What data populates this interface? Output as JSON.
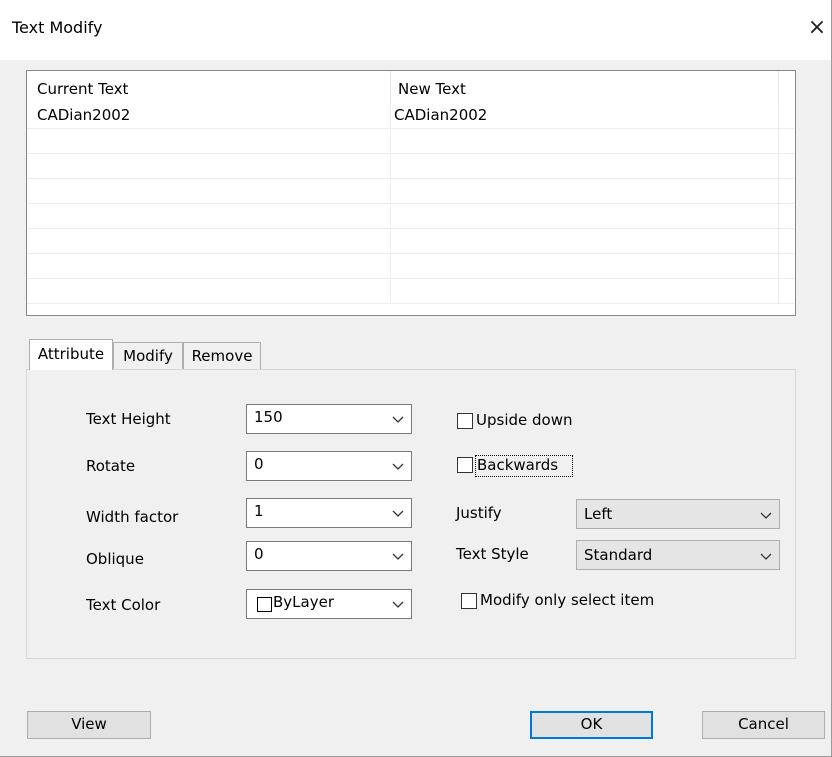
{
  "window": {
    "title": "Text Modify",
    "close_glyph": "×"
  },
  "list": {
    "columns": [
      "Current Text",
      "New Text"
    ],
    "rows": [
      {
        "current": "CADian2002",
        "new": "CADian2002"
      },
      {
        "current": "",
        "new": ""
      },
      {
        "current": "",
        "new": ""
      },
      {
        "current": "",
        "new": ""
      },
      {
        "current": "",
        "new": ""
      },
      {
        "current": "",
        "new": ""
      },
      {
        "current": "",
        "new": ""
      },
      {
        "current": "",
        "new": ""
      }
    ]
  },
  "tabs": [
    {
      "label": "Attribute",
      "active": true
    },
    {
      "label": "Modify",
      "active": false
    },
    {
      "label": "Remove",
      "active": false
    }
  ],
  "attribute": {
    "text_height": {
      "label": "Text Height",
      "value": "150"
    },
    "rotate": {
      "label": "Rotate",
      "value": "0"
    },
    "width_factor": {
      "label": "Width factor",
      "value": "1"
    },
    "oblique": {
      "label": "Oblique",
      "value": "0"
    },
    "text_color": {
      "label": "Text Color",
      "value": "ByLayer"
    },
    "upside_down": {
      "label": "Upside down",
      "checked": false
    },
    "backwards": {
      "label": "Backwards",
      "checked": false
    },
    "justify": {
      "label": "Justify",
      "value": "Left"
    },
    "text_style": {
      "label": "Text Style",
      "value": "Standard"
    },
    "modify_only_select": {
      "label": "Modify only select item",
      "checked": false
    }
  },
  "buttons": {
    "view": "View",
    "ok": "OK",
    "cancel": "Cancel"
  }
}
